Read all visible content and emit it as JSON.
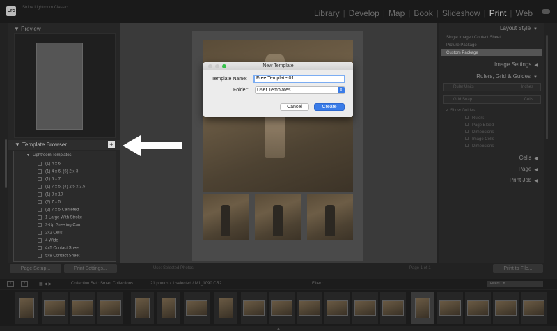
{
  "app": {
    "logo_text": "Lrc",
    "identity_text": "Stripe Lightroom Classic",
    "modules": [
      "Library",
      "Develop",
      "Map",
      "Book",
      "Slideshow",
      "Print",
      "Web"
    ],
    "active_module": "Print",
    "cloud_icon": "cloud-icon"
  },
  "left_panel": {
    "preview_title": "Preview",
    "template_browser_title": "Template Browser",
    "add_button_label": "+",
    "folder_label": "Lightroom Templates",
    "templates": [
      "(1) 4 x 6",
      "(1) 4 x 6, (6) 2 x 3",
      "(1) 5 x 7",
      "(1) 7 x 5, (4) 2.5 x 3.5",
      "(1) 8 x 10",
      "(2) 7 x 5",
      "(2) 7 x 5 Centered",
      "1 Large With Stroke",
      "2-Up Greeting Card",
      "2x2 Cells",
      "4 Wide",
      "4x5 Contact Sheet",
      "5x8 Contact Sheet"
    ],
    "page_setup_label": "Page Setup...",
    "print_settings_label": "Print Settings..."
  },
  "center": {
    "toolbar_text": "Use: Selected Photos",
    "page_count_text": "Page 1 of 1"
  },
  "right_panel": {
    "layout_style_title": "Layout Style",
    "layout_styles": [
      "Single Image / Contact Sheet",
      "Picture Package",
      "Custom Package"
    ],
    "selected_layout_style": "Custom Package",
    "image_settings_title": "Image Settings",
    "rulers_title": "Rulers, Grid & Guides",
    "ruler_units_label": "Ruler Units",
    "ruler_units_value": "Inches",
    "grid_snap_label": "Grid Snap",
    "grid_snap_value": "Cells",
    "show_guides_label": "Show Guides",
    "guides": [
      "Rulers",
      "Page Bleed",
      "Dimensions",
      "Image Cells",
      "Dimensions"
    ],
    "cells_title": "Cells",
    "page_title": "Page",
    "print_job_title": "Print Job",
    "print_to_file_label": "Print to File..."
  },
  "filmstrip_toolbar": {
    "collection_text": "Collection Set : Smart Collections",
    "photos_text": "21 photos / 1 selected / M1_1090.CR2",
    "filter_label": "Filter :",
    "filter_value": "Filters Off",
    "page_numbers": [
      "1",
      "2"
    ]
  },
  "dialog": {
    "title": "New Template",
    "template_name_label": "Template Name:",
    "template_name_value": "Free Template 01",
    "folder_label": "Folder:",
    "folder_value": "User Templates",
    "cancel_label": "Cancel",
    "create_label": "Create",
    "traffic_colors": [
      "#c9c9c9",
      "#c9c9c9",
      "#36c24a"
    ]
  },
  "annotation": {
    "arrow_color": "#ffffff"
  }
}
